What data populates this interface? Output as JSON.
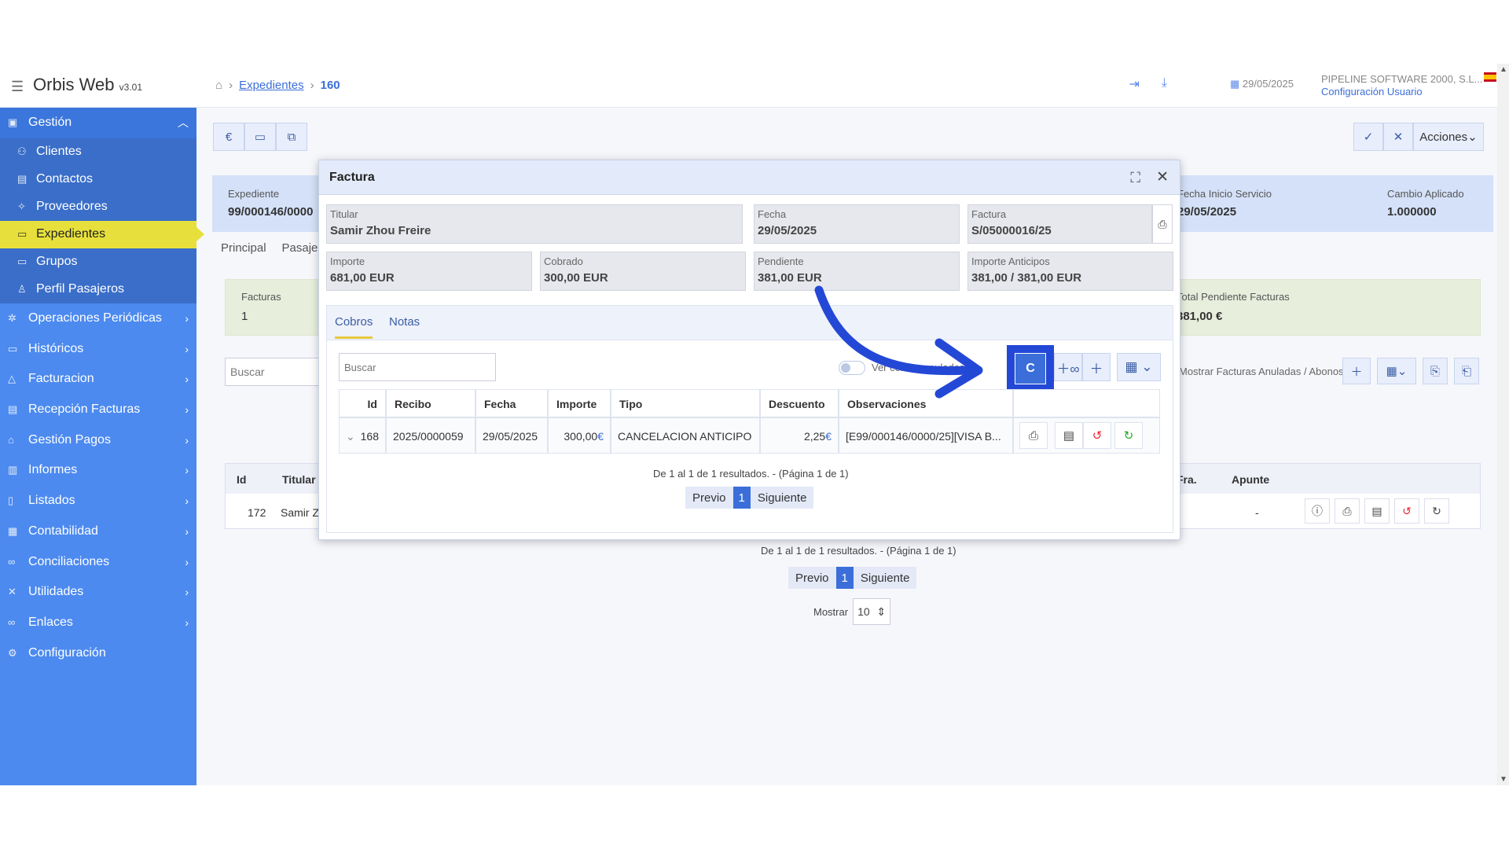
{
  "header": {
    "app_name": "Orbis Web",
    "version": "v3.01",
    "breadcrumb": [
      "Expedientes",
      "160"
    ],
    "date": "29/05/2025",
    "company": "PIPELINE SOFTWARE 2000, S.L...",
    "config_link": "Configuración Usuario"
  },
  "sidebar": {
    "items": [
      {
        "label": "Gestión",
        "kind": "head",
        "icon": "briefcase-icon"
      },
      {
        "label": "Clientes",
        "kind": "sub",
        "icon": "users-icon"
      },
      {
        "label": "Contactos",
        "kind": "sub",
        "icon": "address-card-icon"
      },
      {
        "label": "Proveedores",
        "kind": "sub",
        "icon": "handshake-icon"
      },
      {
        "label": "Expedientes",
        "kind": "active",
        "icon": "folder-icon"
      },
      {
        "label": "Grupos",
        "kind": "sub",
        "icon": "folder-icon"
      },
      {
        "label": "Perfil Pasajeros",
        "kind": "sub",
        "icon": "user-icon"
      },
      {
        "label": "Operaciones Periódicas",
        "kind": "item",
        "icon": "cogs-icon"
      },
      {
        "label": "Históricos",
        "kind": "item",
        "icon": "folder-icon"
      },
      {
        "label": "Facturacion",
        "kind": "item",
        "icon": "flask-icon"
      },
      {
        "label": "Recepción Facturas",
        "kind": "item",
        "icon": "inbox-icon"
      },
      {
        "label": "Gestión Pagos",
        "kind": "item",
        "icon": "bank-icon"
      },
      {
        "label": "Informes",
        "kind": "item",
        "icon": "report-icon"
      },
      {
        "label": "Listados",
        "kind": "item",
        "icon": "list-icon"
      },
      {
        "label": "Contabilidad",
        "kind": "item",
        "icon": "calculator-icon"
      },
      {
        "label": "Conciliaciones",
        "kind": "item",
        "icon": "link-icon"
      },
      {
        "label": "Utilidades",
        "kind": "item",
        "icon": "tools-icon"
      },
      {
        "label": "Enlaces",
        "kind": "item",
        "icon": "link-icon"
      },
      {
        "label": "Configuración",
        "kind": "item",
        "icon": "gear-icon"
      }
    ]
  },
  "background": {
    "acciones_label": "Acciones",
    "expediente_label": "Expediente",
    "expediente_value": "99/000146/0000",
    "fecha_inicio_label": "Fecha Inicio Servicio",
    "fecha_inicio_value": "29/05/2025",
    "cambio_label": "Cambio Aplicado",
    "cambio_value": "1.000000",
    "tab_principal": "Principal",
    "tab_pasajeros": "Pasaje",
    "facturas_label": "Facturas",
    "facturas_value": "1",
    "pendiente_label": "Total Pendiente Facturas",
    "pendiente_value": "381,00 €",
    "search_placeholder": "Buscar",
    "filter_label": "Mostrar Facturas Anuladas / Abonos",
    "col_id": "Id",
    "col_titular": "Titular",
    "col_fra": "Fra.",
    "col_apunte": "Apunte",
    "row_id": "172",
    "row_titular": "Samir Z",
    "row_apunte": "-",
    "pager_text": "De 1 al 1 de 1 resultados. - (Página 1 de 1)",
    "prev": "Previo",
    "page": "1",
    "next": "Siguiente",
    "mostrar_label": "Mostrar",
    "mostrar_value": "10"
  },
  "modal": {
    "title": "Factura",
    "fields": {
      "titular_label": "Titular",
      "titular_value": "Samir Zhou Freire",
      "fecha_label": "Fecha",
      "fecha_value": "29/05/2025",
      "factura_label": "Factura",
      "factura_value": "S/05000016/25",
      "importe_label": "Importe",
      "importe_value": "681,00 EUR",
      "cobrado_label": "Cobrado",
      "cobrado_value": "300,00 EUR",
      "pendiente_label": "Pendiente",
      "pendiente_value": "381,00 EUR",
      "anticipos_label": "Importe Anticipos",
      "anticipos_value": "381,00 / 381,00 EUR"
    },
    "tabs": [
      "Cobros",
      "Notas"
    ],
    "search_placeholder": "Buscar",
    "toggle_label": "Ver cobros anulados",
    "c_button": "C",
    "columns": [
      "Id",
      "Recibo",
      "Fecha",
      "Importe",
      "Tipo",
      "Descuento",
      "Observaciones"
    ],
    "row": {
      "id": "168",
      "recibo": "2025/0000059",
      "fecha": "29/05/2025",
      "importe": "300,00",
      "tipo": "CANCELACION ANTICIPO",
      "descuento": "2,25",
      "observaciones": "[E99/000146/0000/25][VISA B...",
      "currency": "€"
    },
    "pager_text": "De 1 al 1 de 1 resultados. - (Página 1 de 1)",
    "prev": "Previo",
    "page": "1",
    "next": "Siguiente"
  },
  "colors": {
    "sidebar": "#4c8af0",
    "active": "#e7e03c",
    "accent": "#3b6ed9",
    "annotation_arrow": "#2448d6"
  }
}
